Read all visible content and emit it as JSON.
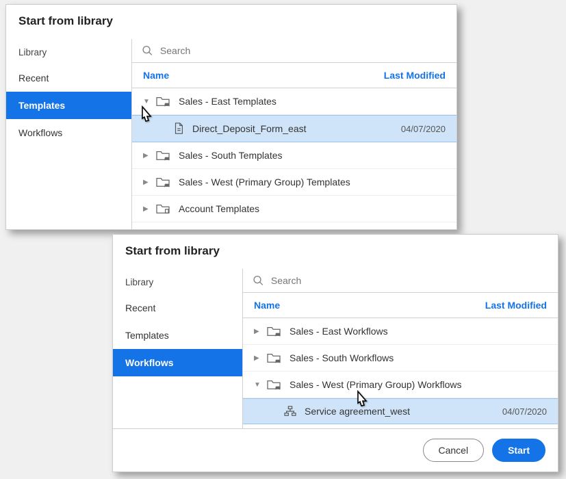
{
  "top": {
    "title": "Start from library",
    "sidebar_head": "Library",
    "sidebar": [
      "Recent",
      "Templates",
      "Workflows"
    ],
    "active": 1,
    "search_placeholder": "Search",
    "col_name": "Name",
    "col_mod": "Last Modified",
    "rows": [
      {
        "label": "Sales - East Templates",
        "expanded": true
      },
      {
        "label": "Direct_Deposit_Form_east",
        "child": true,
        "date": "04/07/2020"
      },
      {
        "label": "Sales - South Templates",
        "expanded": false
      },
      {
        "label": "Sales - West (Primary Group) Templates",
        "expanded": false
      },
      {
        "label": "Account Templates",
        "expanded": false,
        "account": true
      }
    ]
  },
  "bottom": {
    "title": "Start from library",
    "sidebar_head": "Library",
    "sidebar": [
      "Recent",
      "Templates",
      "Workflows"
    ],
    "active": 2,
    "search_placeholder": "Search",
    "col_name": "Name",
    "col_mod": "Last Modified",
    "rows": [
      {
        "label": "Sales - East Workflows",
        "expanded": false
      },
      {
        "label": "Sales - South Workflows",
        "expanded": false
      },
      {
        "label": "Sales - West (Primary Group) Workflows",
        "expanded": true
      },
      {
        "label": "Service agreement_west",
        "child": true,
        "date": "04/07/2020",
        "workflow": true
      }
    ],
    "cancel": "Cancel",
    "start": "Start"
  }
}
